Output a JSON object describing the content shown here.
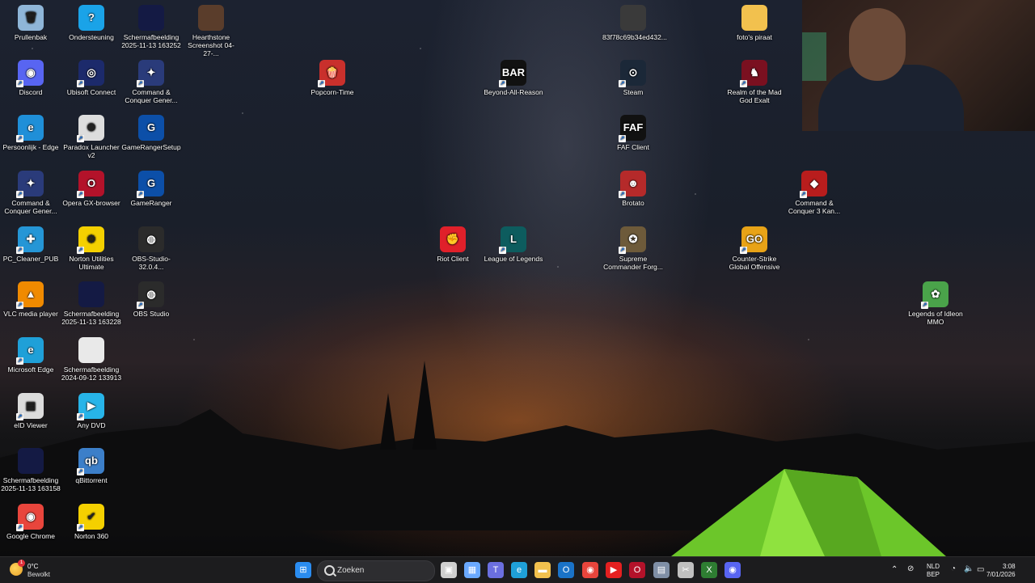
{
  "desktop": {
    "icons": [
      {
        "label": "Prullenbak",
        "glyph": "🗑",
        "color": "#8fb6d8",
        "shortcut": false
      },
      {
        "label": "Ondersteuning",
        "glyph": "?",
        "color": "#1aa3e8",
        "shortcut": false
      },
      {
        "label": "Schermafbeelding 2025-11-13 163252",
        "glyph": "",
        "color": "#141a44",
        "shortcut": false
      },
      {
        "label": "Hearthstone Screenshot 04-27-...",
        "glyph": "",
        "color": "#5a3d2b",
        "shortcut": false
      },
      {
        "label": "Discord",
        "glyph": "◉",
        "color": "#5865f2",
        "shortcut": true
      },
      {
        "label": "Ubisoft Connect",
        "glyph": "◎",
        "color": "#1c2a6b",
        "shortcut": true
      },
      {
        "label": "Command & Conquer Gener...",
        "glyph": "✦",
        "color": "#2a3b7a",
        "shortcut": true
      },
      {
        "label": "Persoonlijk - Edge",
        "glyph": "e",
        "color": "#1f8fd8",
        "shortcut": true
      },
      {
        "label": "Paradox Launcher v2",
        "glyph": "✺",
        "color": "#dddddd",
        "shortcut": true
      },
      {
        "label": "GameRangerSetup",
        "glyph": "G",
        "color": "#0c4fa8",
        "shortcut": false
      },
      {
        "label": "Command & Conquer Gener...",
        "glyph": "✦",
        "color": "#2a3b7a",
        "shortcut": true
      },
      {
        "label": "Opera GX-browser",
        "glyph": "O",
        "color": "#b3122a",
        "shortcut": true
      },
      {
        "label": "GameRanger",
        "glyph": "G",
        "color": "#0c4fa8",
        "shortcut": true
      },
      {
        "label": "PC_Cleaner_PUB",
        "glyph": "✚",
        "color": "#2596d6",
        "shortcut": true
      },
      {
        "label": "Norton Utilities Ultimate",
        "glyph": "⚙",
        "color": "#f4d000",
        "shortcut": true
      },
      {
        "label": "OBS-Studio-32.0.4...",
        "glyph": "◍",
        "color": "#2b2b2b",
        "shortcut": false
      },
      {
        "label": "VLC media player",
        "glyph": "▲",
        "color": "#f08a00",
        "shortcut": true
      },
      {
        "label": "Schermafbeelding 2025-11-13 163228",
        "glyph": "",
        "color": "#141a44",
        "shortcut": false
      },
      {
        "label": "OBS Studio",
        "glyph": "◍",
        "color": "#2b2b2b",
        "shortcut": true
      },
      {
        "label": "Microsoft Edge",
        "glyph": "e",
        "color": "#1fa0d8",
        "shortcut": true
      },
      {
        "label": "Schermafbeelding 2024-09-12 133913",
        "glyph": "",
        "color": "#e9e9e9",
        "shortcut": false
      },
      {
        "label": "eID Viewer",
        "glyph": "▤",
        "color": "#dcdcdc",
        "shortcut": true
      },
      {
        "label": "Any DVD",
        "glyph": "▶",
        "color": "#27b4e8",
        "shortcut": true
      },
      {
        "label": "Schermafbeelding 2025-11-13 163158",
        "glyph": "",
        "color": "#141a44",
        "shortcut": false
      },
      {
        "label": "qBittorrent",
        "glyph": "qb",
        "color": "#3c7fc9",
        "shortcut": true
      },
      {
        "label": "Google Chrome",
        "glyph": "◉",
        "color": "#e8453c",
        "shortcut": true
      },
      {
        "label": "Norton 360",
        "glyph": "✔",
        "color": "#f4d000",
        "shortcut": true
      },
      {
        "label": "Popcorn-Time",
        "glyph": "🍿",
        "color": "#c9302c",
        "shortcut": true
      },
      {
        "label": "83f78c69b34ed432...",
        "glyph": "",
        "color": "#3a3a3a",
        "shortcut": false
      },
      {
        "label": "foto's piraat",
        "glyph": "",
        "color": "#f2c14e",
        "shortcut": false
      },
      {
        "label": "Beyond-All-Reason",
        "glyph": "BAR",
        "color": "#111111",
        "shortcut": true
      },
      {
        "label": "Steam",
        "glyph": "⊙",
        "color": "#1b2838",
        "shortcut": true
      },
      {
        "label": "Realm of the Mad God Exalt",
        "glyph": "♞",
        "color": "#7a1020",
        "shortcut": true
      },
      {
        "label": "FAF Client",
        "glyph": "FAF",
        "color": "#111111",
        "shortcut": true
      },
      {
        "label": "Brotato",
        "glyph": "☻",
        "color": "#b52a2a",
        "shortcut": true
      },
      {
        "label": "Command & Conquer 3 Kan...",
        "glyph": "◆",
        "color": "#b81d1d",
        "shortcut": true
      },
      {
        "label": "Riot Client",
        "glyph": "✊",
        "color": "#e0202a",
        "shortcut": false
      },
      {
        "label": "League of Legends",
        "glyph": "L",
        "color": "#0d5c5e",
        "shortcut": true
      },
      {
        "label": "Supreme Commander Forg...",
        "glyph": "✪",
        "color": "#6d5a3a",
        "shortcut": true
      },
      {
        "label": "Counter-Strike Global Offensive",
        "glyph": "GO",
        "color": "#e8a317",
        "shortcut": true
      },
      {
        "label": "Legends of Idleon MMO",
        "glyph": "✿",
        "color": "#4aa34a",
        "shortcut": true
      }
    ]
  },
  "taskbar": {
    "weather": {
      "temp": "0°C",
      "desc": "Bewolkt",
      "badge": "1"
    },
    "search_placeholder": "Zoeken",
    "apps": [
      {
        "name": "start",
        "glyph": "⊞",
        "color": "#2a8cf0"
      },
      {
        "name": "task-view",
        "glyph": "▣",
        "color": "#cfcfcf"
      },
      {
        "name": "store",
        "glyph": "▦",
        "color": "#6aa9ff"
      },
      {
        "name": "teams",
        "glyph": "T",
        "color": "#6b6fe0"
      },
      {
        "name": "edge",
        "glyph": "e",
        "color": "#1fa0d8"
      },
      {
        "name": "explorer",
        "glyph": "▬",
        "color": "#f2c14e"
      },
      {
        "name": "outlook",
        "glyph": "O",
        "color": "#1a73c8"
      },
      {
        "name": "chrome",
        "glyph": "◉",
        "color": "#e8453c"
      },
      {
        "name": "youtube",
        "glyph": "▶",
        "color": "#e52020"
      },
      {
        "name": "opera-gx",
        "glyph": "O",
        "color": "#b3122a"
      },
      {
        "name": "calculator",
        "glyph": "▤",
        "color": "#7f8fa6"
      },
      {
        "name": "snipping",
        "glyph": "✂",
        "color": "#c0c0c0"
      },
      {
        "name": "excel-like",
        "glyph": "X",
        "color": "#2e7d32"
      },
      {
        "name": "discord",
        "glyph": "◉",
        "color": "#5865f2"
      }
    ],
    "tray": {
      "lang1": "NLD",
      "lang2": "BEP",
      "time": "3:08",
      "date": "7/01/2026"
    }
  }
}
